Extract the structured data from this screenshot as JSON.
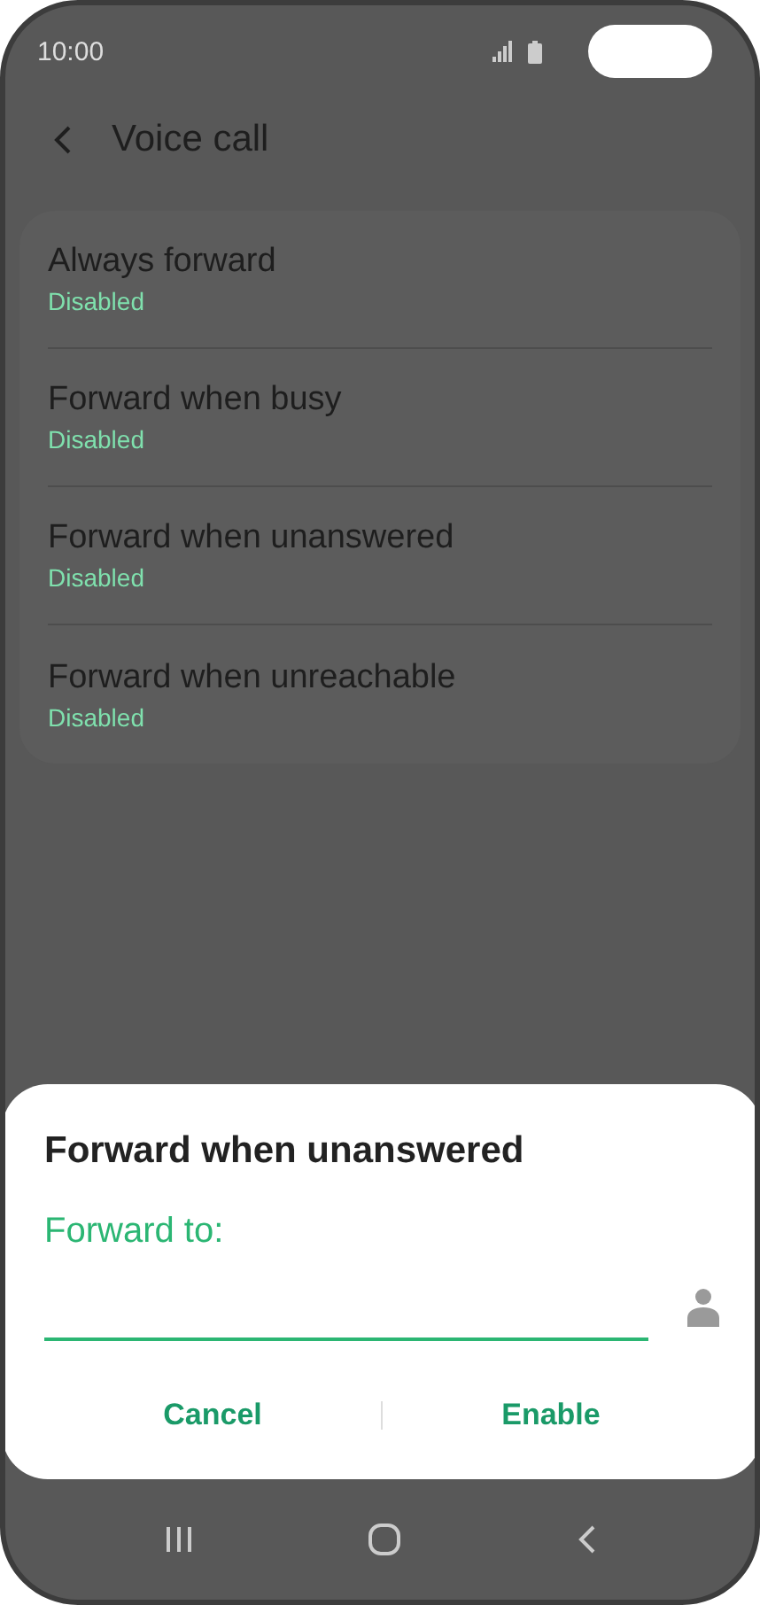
{
  "status_bar": {
    "time": "10:00"
  },
  "header": {
    "title": "Voice call"
  },
  "options": [
    {
      "title": "Always forward",
      "status": "Disabled"
    },
    {
      "title": "Forward when busy",
      "status": "Disabled"
    },
    {
      "title": "Forward when unanswered",
      "status": "Disabled"
    },
    {
      "title": "Forward when unreachable",
      "status": "Disabled"
    }
  ],
  "dialog": {
    "title": "Forward when unanswered",
    "field_label": "Forward to:",
    "buttons": [
      "Cancel",
      "Enable"
    ]
  }
}
